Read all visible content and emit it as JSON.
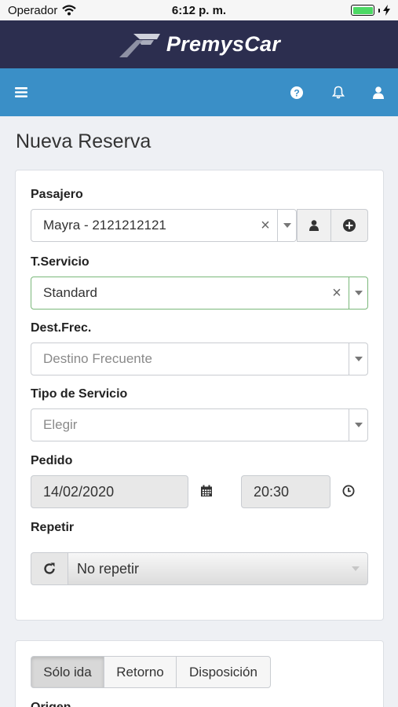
{
  "status_bar": {
    "carrier": "Operador",
    "time": "6:12 p. m."
  },
  "brand": {
    "name": "PremysCar"
  },
  "nav": {
    "icons": [
      "menu-icon",
      "help-icon",
      "bell-icon",
      "user-icon"
    ]
  },
  "page": {
    "title": "Nueva Reserva"
  },
  "form": {
    "pasajero": {
      "label": "Pasajero",
      "value": "Mayra - 2121212121",
      "clear": "×"
    },
    "tservicio": {
      "label": "T.Servicio",
      "value": "Standard",
      "clear": "×"
    },
    "destfrec": {
      "label": "Dest.Frec.",
      "placeholder": "Destino Frecuente"
    },
    "tipo_servicio": {
      "label": "Tipo de Servicio",
      "placeholder": "Elegir"
    },
    "pedido": {
      "label": "Pedido",
      "date": "14/02/2020",
      "time": "20:30"
    },
    "repetir": {
      "label": "Repetir",
      "value": "No repetir"
    }
  },
  "trip": {
    "tabs": [
      "Sólo ida",
      "Retorno",
      "Disposición"
    ],
    "selected_tab": "Sólo ida",
    "origin_label": "Origen"
  },
  "colors": {
    "brand_bar": "#2c2e4f",
    "nav_bar": "#3a8fc7",
    "active_border": "#7ab87a",
    "battery": "#4cd964"
  }
}
